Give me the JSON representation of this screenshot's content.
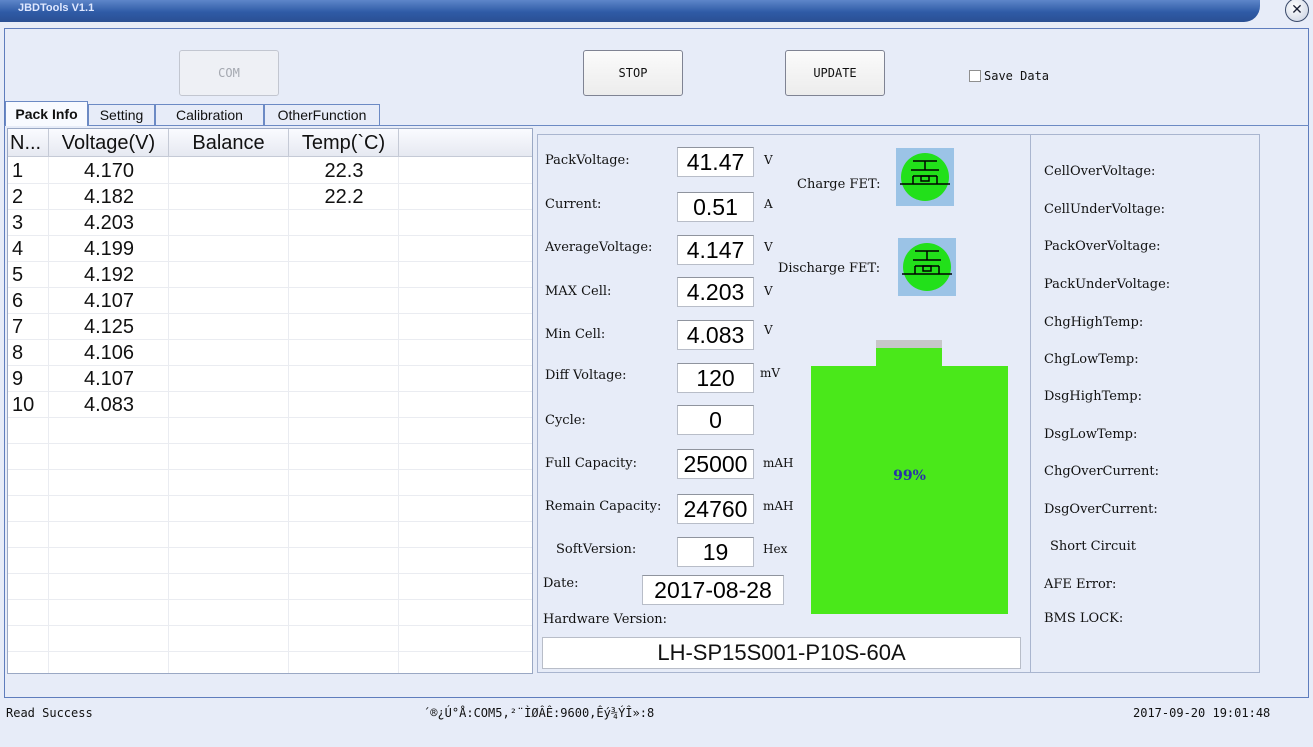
{
  "window": {
    "title": "JBDTools V1.1",
    "close_glyph": "✕"
  },
  "toolbar": {
    "com_label": "COM",
    "stop_label": "STOP",
    "update_label": "UPDATE",
    "save_data_label": "Save Data"
  },
  "tabs": [
    {
      "label": "Pack Info",
      "active": true
    },
    {
      "label": "Setting"
    },
    {
      "label": "Calibration"
    },
    {
      "label": "OtherFunction"
    }
  ],
  "cell_table": {
    "headers": [
      "N...",
      "Voltage(V)",
      "Balance",
      "Temp(`C)"
    ],
    "rows": [
      {
        "n": "1",
        "voltage": "4.170",
        "balance": "",
        "temp": "22.3"
      },
      {
        "n": "2",
        "voltage": "4.182",
        "balance": "",
        "temp": "22.2"
      },
      {
        "n": "3",
        "voltage": "4.203",
        "balance": "",
        "temp": ""
      },
      {
        "n": "4",
        "voltage": "4.199",
        "balance": "",
        "temp": ""
      },
      {
        "n": "5",
        "voltage": "4.192",
        "balance": "",
        "temp": ""
      },
      {
        "n": "6",
        "voltage": "4.107",
        "balance": "",
        "temp": ""
      },
      {
        "n": "7",
        "voltage": "4.125",
        "balance": "",
        "temp": ""
      },
      {
        "n": "8",
        "voltage": "4.106",
        "balance": "",
        "temp": ""
      },
      {
        "n": "9",
        "voltage": "4.107",
        "balance": "",
        "temp": ""
      },
      {
        "n": "10",
        "voltage": "4.083",
        "balance": "",
        "temp": ""
      }
    ]
  },
  "pack": {
    "pack_voltage": {
      "label": "PackVoltage:",
      "value": "41.47",
      "unit": "V"
    },
    "current": {
      "label": "Current:",
      "value": "0.51",
      "unit": "A"
    },
    "average_voltage": {
      "label": "AverageVoltage:",
      "value": "4.147",
      "unit": "V"
    },
    "max_cell": {
      "label": "MAX Cell:",
      "value": "4.203",
      "unit": "V"
    },
    "min_cell": {
      "label": "Min Cell:",
      "value": "4.083",
      "unit": "V"
    },
    "diff_voltage": {
      "label": "Diff Voltage:",
      "value": "120",
      "unit": "mV"
    },
    "cycle": {
      "label": "Cycle:",
      "value": "0"
    },
    "full_capacity": {
      "label": "Full Capacity:",
      "value": "25000",
      "unit": "mAH"
    },
    "remain_capacity": {
      "label": "Remain Capacity:",
      "value": "24760",
      "unit": "mAH"
    },
    "soft_version": {
      "label": "SoftVersion:",
      "value": "19",
      "unit": "Hex"
    },
    "date": {
      "label": "Date:",
      "value": "2017-08-28"
    },
    "hardware_version": {
      "label": "Hardware Version:",
      "value": "LH-SP15S001-P10S-60A"
    }
  },
  "fets": {
    "charge_label": "Charge FET:",
    "discharge_label": "Discharge FET:",
    "on_color": "#22e01a",
    "bg_color": "#9bc3e6"
  },
  "battery": {
    "percent_label": "99%",
    "level": 0.99,
    "fill_color": "#4ae81a",
    "text_color": "#2a32a8"
  },
  "protection": [
    "CellOverVoltage:",
    "CellUnderVoltage:",
    "PackOverVoltage:",
    "PackUnderVoltage:",
    "ChgHighTemp:",
    "ChgLowTemp:",
    "DsgHighTemp:",
    "DsgLowTemp:",
    "ChgOverCurrent:",
    "DsgOverCurrent:",
    "Short Circuit",
    "AFE Error:",
    "BMS LOCK:"
  ],
  "statusbar": {
    "left": "Read Success",
    "middle": "´®¿Ú°Å:COM5,²¨ÌØÂÊ:9600,Êý¾ÝÎ»:8",
    "right": "2017-09-20 19:01:48"
  }
}
